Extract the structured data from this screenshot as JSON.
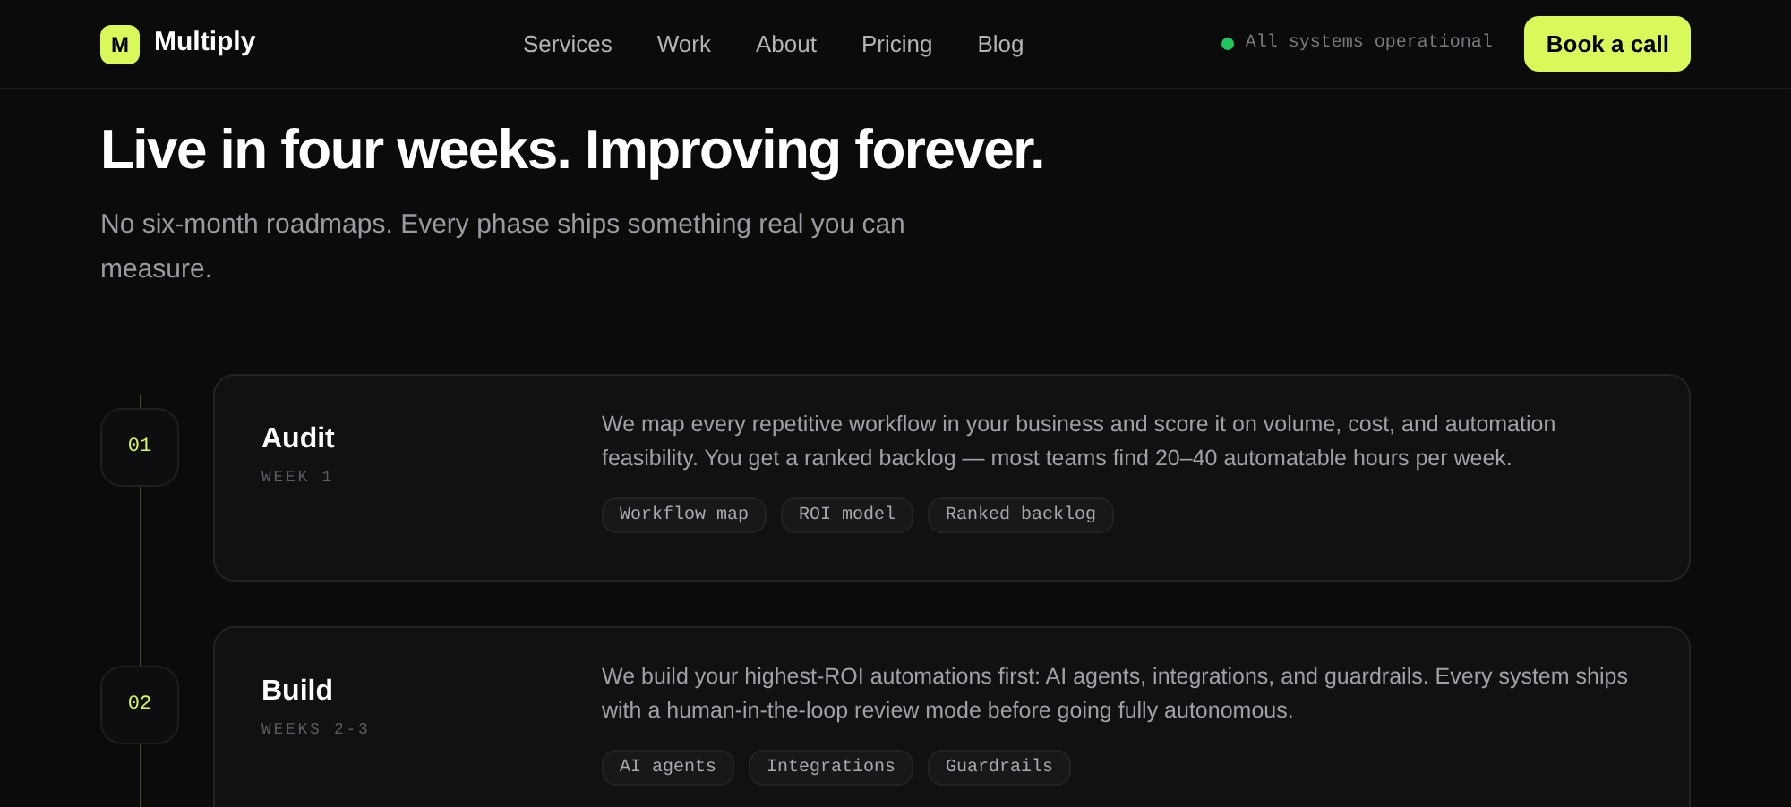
{
  "brand": {
    "logo_letter": "M",
    "name": "Multiply"
  },
  "nav": [
    "Services",
    "Work",
    "About",
    "Pricing",
    "Blog"
  ],
  "status": {
    "text": "All systems operational",
    "color": "#22c55e"
  },
  "cta": "Book a call",
  "hero": {
    "title": "Live in four weeks. Improving forever.",
    "subtitle": "No six-month roadmaps. Every phase ships something real you can measure."
  },
  "phases": [
    {
      "number": "01",
      "title": "Audit",
      "duration": "WEEK 1",
      "description": "We map every repetitive workflow in your business and score it on volume, cost, and automation feasibility. You get a ranked backlog — most teams find 20–40 automatable hours per week.",
      "tags": [
        "Workflow map",
        "ROI model",
        "Ranked backlog"
      ]
    },
    {
      "number": "02",
      "title": "Build",
      "duration": "WEEKS 2-3",
      "description": "We build your highest-ROI automations first: AI agents, integrations, and guardrails. Every system ships with a human-in-the-loop review mode before going fully autonomous.",
      "tags": [
        "AI agents",
        "Integrations",
        "Guardrails"
      ]
    }
  ]
}
